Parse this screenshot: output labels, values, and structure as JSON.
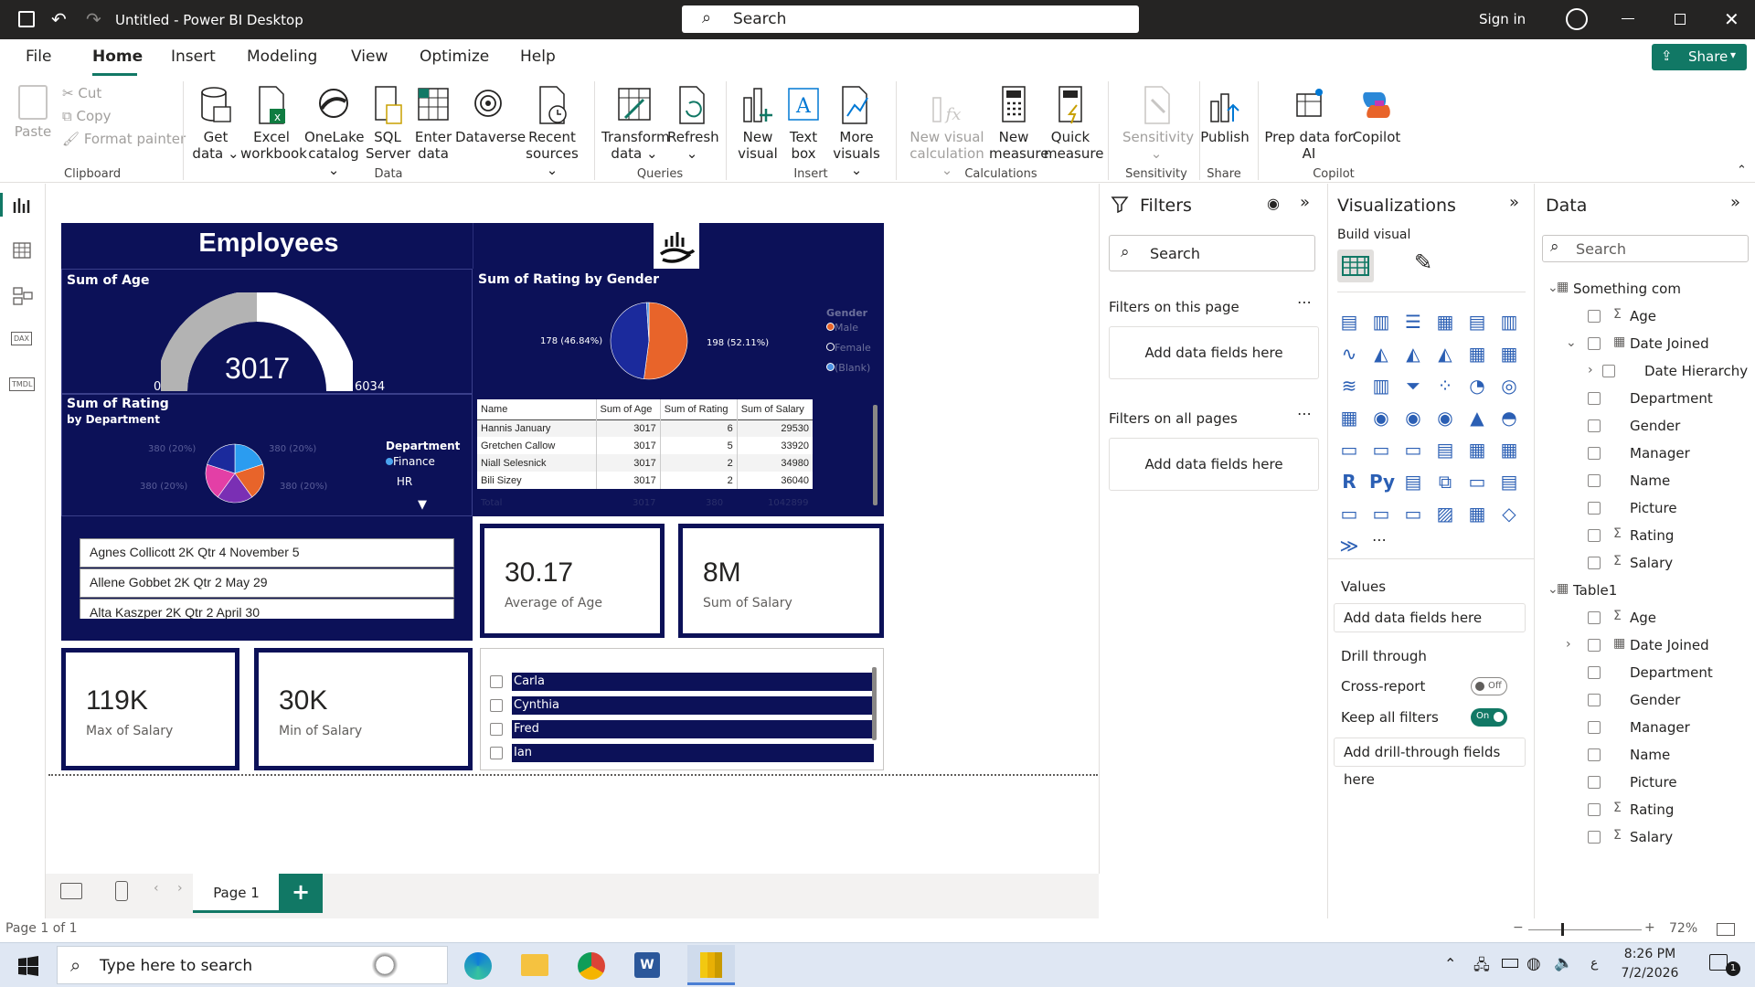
{
  "titlebar": {
    "title": "Untitled - Power BI Desktop",
    "search_placeholder": "Search",
    "sign_in": "Sign in"
  },
  "menu": {
    "file": "File",
    "home": "Home",
    "insert": "Insert",
    "modeling": "Modeling",
    "view": "View",
    "optimize": "Optimize",
    "help": "Help",
    "share": "Share"
  },
  "ribbon": {
    "paste": "Paste",
    "cut": "Cut",
    "copy": "Copy",
    "format_painter": "Format painter",
    "clipboard": "Clipboard",
    "get_data_1": "Get",
    "get_data_2": "data",
    "excel_1": "Excel",
    "excel_2": "workbook",
    "onelake_1": "OneLake",
    "onelake_2": "catalog",
    "sql_1": "SQL",
    "sql_2": "Server",
    "enter_1": "Enter",
    "enter_2": "data",
    "dataverse": "Dataverse",
    "recent_1": "Recent",
    "recent_2": "sources",
    "data_group": "Data",
    "transform_1": "Transform",
    "transform_2": "data",
    "refresh": "Refresh",
    "queries_group": "Queries",
    "new_visual_1": "New",
    "new_visual_2": "visual",
    "text_box_1": "Text",
    "text_box_2": "box",
    "more_visuals_1": "More",
    "more_visuals_2": "visuals",
    "insert_group": "Insert",
    "new_calc_1": "New visual",
    "new_calc_2": "calculation",
    "new_measure_1": "New",
    "new_measure_2": "measure",
    "quick_measure_1": "Quick",
    "quick_measure_2": "measure",
    "calculations_group": "Calculations",
    "sensitivity": "Sensitivity",
    "sensitivity_group": "Sensitivity",
    "publish": "Publish",
    "share_group": "Share",
    "copilot_1": "Prep data for",
    "copilot_2": "AI",
    "copilot_label": "Copilot",
    "copilot_group": "Copilot"
  },
  "report": {
    "title": "Employees",
    "gauge": {
      "title": "Sum of Age",
      "value": "3017",
      "min": "0",
      "max": "6034",
      "fill_fraction": 0.5
    },
    "donut": {
      "title": "Sum of Rating by Gender",
      "left_label": "178 (46.84%)",
      "right_label": "198 (52.11%)",
      "legend_title": "Gender",
      "legend": [
        "Male",
        "Female",
        "(Blank)"
      ]
    },
    "pie": {
      "title": "Sum of Rating",
      "subtitle": "by Department",
      "labels": [
        "380 (20%)",
        "380 (20%)",
        "380 (20%)",
        "380 (20%)"
      ],
      "legend_title": "Department",
      "legend": [
        "Finance",
        "HR"
      ]
    },
    "table": {
      "headers": [
        "Name",
        "Sum of Age",
        "Sum of Rating",
        "Sum of Salary"
      ],
      "rows": [
        [
          "Hannis January",
          "3017",
          "6",
          "29530"
        ],
        [
          "Gretchen Callow",
          "3017",
          "5",
          "33920"
        ],
        [
          "Niall Selesnick",
          "3017",
          "2",
          "34980"
        ],
        [
          "Bili Sizey",
          "3017",
          "2",
          "36040"
        ]
      ],
      "total": [
        "Total",
        "3017",
        "380",
        "1042899"
      ]
    },
    "list": [
      "Agnes Collicott 2K Qtr 4 November 5",
      "Allene Gobbet 2K Qtr 2 May 29",
      "Alta Kaszper 2K Qtr 2 April 30"
    ],
    "cards": [
      {
        "value": "30.17",
        "label": "Average of Age"
      },
      {
        "value": "8M",
        "label": "Sum of Salary"
      },
      {
        "value": "119K",
        "label": "Max of Salary"
      },
      {
        "value": "30K",
        "label": "Min of Salary"
      }
    ],
    "slicer": [
      "Carla",
      "Cynthia",
      "Fred",
      "Ian"
    ]
  },
  "filters": {
    "title": "Filters",
    "search": "Search",
    "on_page": "Filters on this page",
    "on_all": "Filters on all pages",
    "add": "Add data fields here"
  },
  "viz": {
    "title": "Visualizations",
    "build": "Build visual",
    "values": "Values",
    "add": "Add data fields here",
    "drill": "Drill through",
    "cross": "Cross-report",
    "cross_state": "Off",
    "keep": "Keep all filters",
    "keep_state": "On",
    "add_drill": "Add drill-through fields here"
  },
  "data": {
    "title": "Data",
    "search": "Search",
    "table1_name": "Something com",
    "table1_fields": [
      "Age",
      "Date Joined",
      "Date Hierarchy",
      "Department",
      "Gender",
      "Manager",
      "Name",
      "Picture",
      "Rating",
      "Salary"
    ],
    "table2_name": "Table1",
    "table2_fields": [
      "Age",
      "Date Joined",
      "Department",
      "Gender",
      "Manager",
      "Name",
      "Picture",
      "Rating",
      "Salary"
    ]
  },
  "pages": {
    "page1": "Page 1",
    "status": "Page 1 of 1",
    "zoom": "72%"
  },
  "taskbar": {
    "search": "Type here to search",
    "time": "8:26 PM",
    "date": "7/2/2026",
    "notif": "1"
  },
  "colors": {
    "navy": "#0c1158",
    "orange": "#e8642a",
    "blue": "#1b2a9c",
    "accent": "#117865"
  }
}
